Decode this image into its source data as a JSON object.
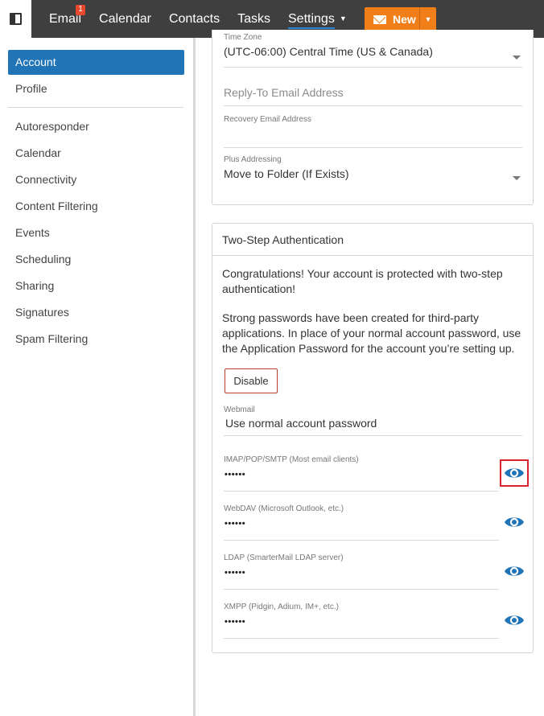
{
  "topnav": {
    "email": "Email",
    "email_badge": "1",
    "calendar": "Calendar",
    "contacts": "Contacts",
    "tasks": "Tasks",
    "settings": "Settings",
    "new": "New"
  },
  "sidebar": {
    "items": [
      {
        "label": "Account"
      },
      {
        "label": "Profile"
      },
      {
        "label": "Autoresponder"
      },
      {
        "label": "Calendar"
      },
      {
        "label": "Connectivity"
      },
      {
        "label": "Content Filtering"
      },
      {
        "label": "Events"
      },
      {
        "label": "Scheduling"
      },
      {
        "label": "Sharing"
      },
      {
        "label": "Signatures"
      },
      {
        "label": "Spam Filtering"
      }
    ]
  },
  "account": {
    "timezone_label": "Time Zone",
    "timezone_value": "(UTC-06:00) Central Time (US & Canada)",
    "reply_to_placeholder": "Reply-To Email Address",
    "recovery_label": "Recovery Email Address",
    "plus_label": "Plus Addressing",
    "plus_value": "Move to Folder (If Exists)"
  },
  "two_step": {
    "title": "Two-Step Authentication",
    "congrats": "Congratulations! Your account is protected with two-step authentication!",
    "strong": "Strong passwords have been created for third-party applications. In place of your normal account password, use the Application Password for the account you’re setting up.",
    "disable": "Disable",
    "webmail_label": "Webmail",
    "webmail_value": "Use normal account password",
    "passwords": [
      {
        "label": "IMAP/POP/SMTP (Most email clients)",
        "value": "••••••"
      },
      {
        "label": "WebDAV (Microsoft Outlook, etc.)",
        "value": "••••••"
      },
      {
        "label": "LDAP (SmarterMail LDAP server)",
        "value": "••••••"
      },
      {
        "label": "XMPP (Pidgin, Adium, IM+, etc.)",
        "value": "••••••"
      }
    ]
  },
  "colors": {
    "accent": "#2174b6",
    "new_button": "#f07f19",
    "topbar": "#3f3f3f",
    "eye": "#2174b6",
    "highlight": "#d9232e"
  }
}
